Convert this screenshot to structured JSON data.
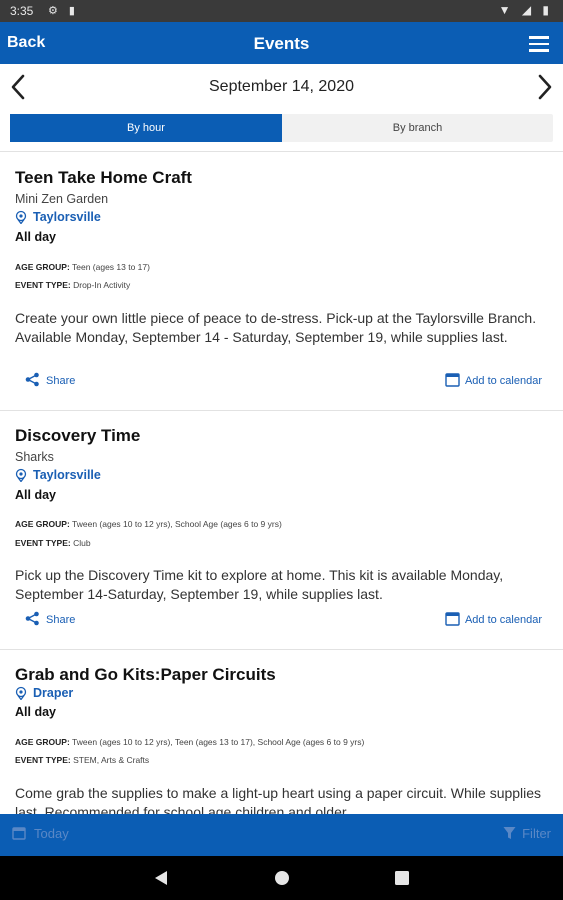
{
  "status_bar": {
    "time": "3:35"
  },
  "app_bar": {
    "back_label": "Back",
    "title": "Events"
  },
  "date_nav": {
    "date": "September 14, 2020"
  },
  "view_toggle": {
    "active": "By hour",
    "inactive": "By branch"
  },
  "labels": {
    "age_group": "AGE GROUP:",
    "event_type": "EVENT TYPE:",
    "share": "Share",
    "add_to_calendar": "Add to calendar"
  },
  "events": [
    {
      "title": "Teen Take Home Craft",
      "subtitle": "Mini Zen Garden",
      "location": "Taylorsville",
      "time": "All day",
      "age_group": "Teen (ages 13 to 17)",
      "event_type": "Drop-In Activity",
      "description": "Create your own little piece of peace to de-stress. Pick-up at the Taylorsville Branch. Available Monday, September 14 - Saturday, September 19, while supplies last."
    },
    {
      "title": "Discovery Time",
      "subtitle": "Sharks",
      "location": "Taylorsville",
      "time": "All day",
      "age_group": "Tween (ages 10 to 12 yrs), School Age (ages 6 to 9 yrs)",
      "event_type": "Club",
      "description": "Pick up the Discovery Time kit to explore at home. This kit is available Monday, September 14-Saturday, September 19, while supplies last."
    },
    {
      "title": "Grab and Go Kits:Paper Circuits",
      "location": "Draper",
      "time": "All day",
      "age_group": "Tween (ages 10 to 12 yrs), Teen (ages 13 to 17), School Age (ages 6 to 9 yrs)",
      "event_type": "STEM, Arts & Crafts",
      "description": "Come grab the supplies to make a light-up heart using a paper circuit. While supplies last. Recommended for school age children and older."
    }
  ],
  "bottom_bar": {
    "left_label": "Today",
    "right_label": "Filter"
  },
  "colors": {
    "primary": "#0b5db4",
    "link": "#1a5fb4"
  }
}
